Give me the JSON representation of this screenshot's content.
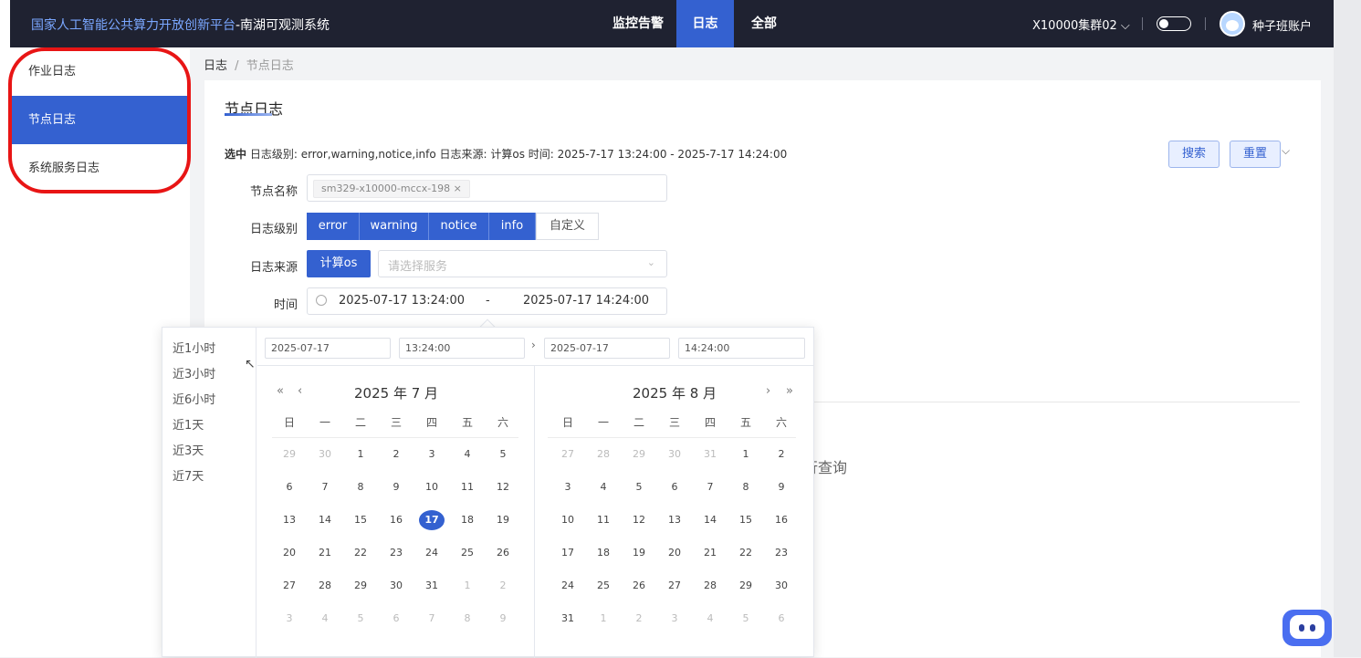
{
  "header": {
    "brand_primary": "国家人工智能公共算力开放创新平台",
    "brand_secondary": "-南湖可观测系统",
    "nav": [
      "监控告警",
      "日志",
      "全部"
    ],
    "cluster": "X10000集群02 ⌵",
    "theme_toggle": "off",
    "account": "种子班账户"
  },
  "sidebar": {
    "items": [
      {
        "label": "作业日志",
        "active": false
      },
      {
        "label": "节点日志",
        "active": true
      },
      {
        "label": "系统服务日志",
        "active": false
      }
    ]
  },
  "breadcrumb": {
    "root": "日志",
    "sep": "/",
    "current": "节点日志"
  },
  "page_title": "节点日志",
  "selection": {
    "label": "选中",
    "text": "日志级别: error,warning,notice,info  日志来源: 计算os  时间: 2025-7-17 13:24:00 - 2025-7-17 14:24:00"
  },
  "actions": {
    "search": "搜索",
    "reset": "重置",
    "expand": "⌵"
  },
  "form": {
    "node_label": "节点名称",
    "node_tag": "sm329-x10000-mccx-198 ×",
    "level_label": "日志级别",
    "levels": [
      "error",
      "warning",
      "notice",
      "info"
    ],
    "custom_label": "自定义",
    "source_label": "日志来源",
    "source_value": "计算os",
    "service_placeholder": "请选择服务",
    "time_label": "时间",
    "time_start": "2025-07-17 13:24:00",
    "time_sep": "-",
    "time_end": "2025-07-17 14:24:00"
  },
  "hint_text": "行查询",
  "picker": {
    "shortcuts": [
      "近1小时",
      "近3小时",
      "近6小时",
      "近1天",
      "近3天",
      "近7天"
    ],
    "start_date": "2025-07-17",
    "start_time": "13:24:00",
    "end_date": "2025-07-17",
    "end_time": "14:24:00",
    "left": {
      "title": "2025 年  7 月",
      "weekdays": [
        "日",
        "一",
        "二",
        "三",
        "四",
        "五",
        "六"
      ],
      "days": [
        "29",
        "30",
        "1",
        "2",
        "3",
        "4",
        "5",
        "6",
        "7",
        "8",
        "9",
        "10",
        "11",
        "12",
        "13",
        "14",
        "15",
        "16",
        "17",
        "18",
        "19",
        "20",
        "21",
        "22",
        "23",
        "24",
        "25",
        "26",
        "27",
        "28",
        "29",
        "30",
        "31",
        "1",
        "2",
        "3",
        "4",
        "5",
        "6",
        "7",
        "8",
        "9"
      ],
      "lead_muted": 2,
      "current_count": 31,
      "selected_day": "17"
    },
    "right": {
      "title": "2025 年  8 月",
      "weekdays": [
        "日",
        "一",
        "二",
        "三",
        "四",
        "五",
        "六"
      ],
      "days": [
        "27",
        "28",
        "29",
        "30",
        "31",
        "1",
        "2",
        "3",
        "4",
        "5",
        "6",
        "7",
        "8",
        "9",
        "10",
        "11",
        "12",
        "13",
        "14",
        "15",
        "16",
        "17",
        "18",
        "19",
        "20",
        "21",
        "22",
        "23",
        "24",
        "25",
        "26",
        "27",
        "28",
        "29",
        "30",
        "31",
        "1",
        "2",
        "3",
        "4",
        "5",
        "6"
      ],
      "lead_muted": 5,
      "current_count": 31
    }
  },
  "colors": {
    "primary": "#3461d0",
    "topbar": "#1f2231",
    "highlight_ring": "#e81515"
  }
}
